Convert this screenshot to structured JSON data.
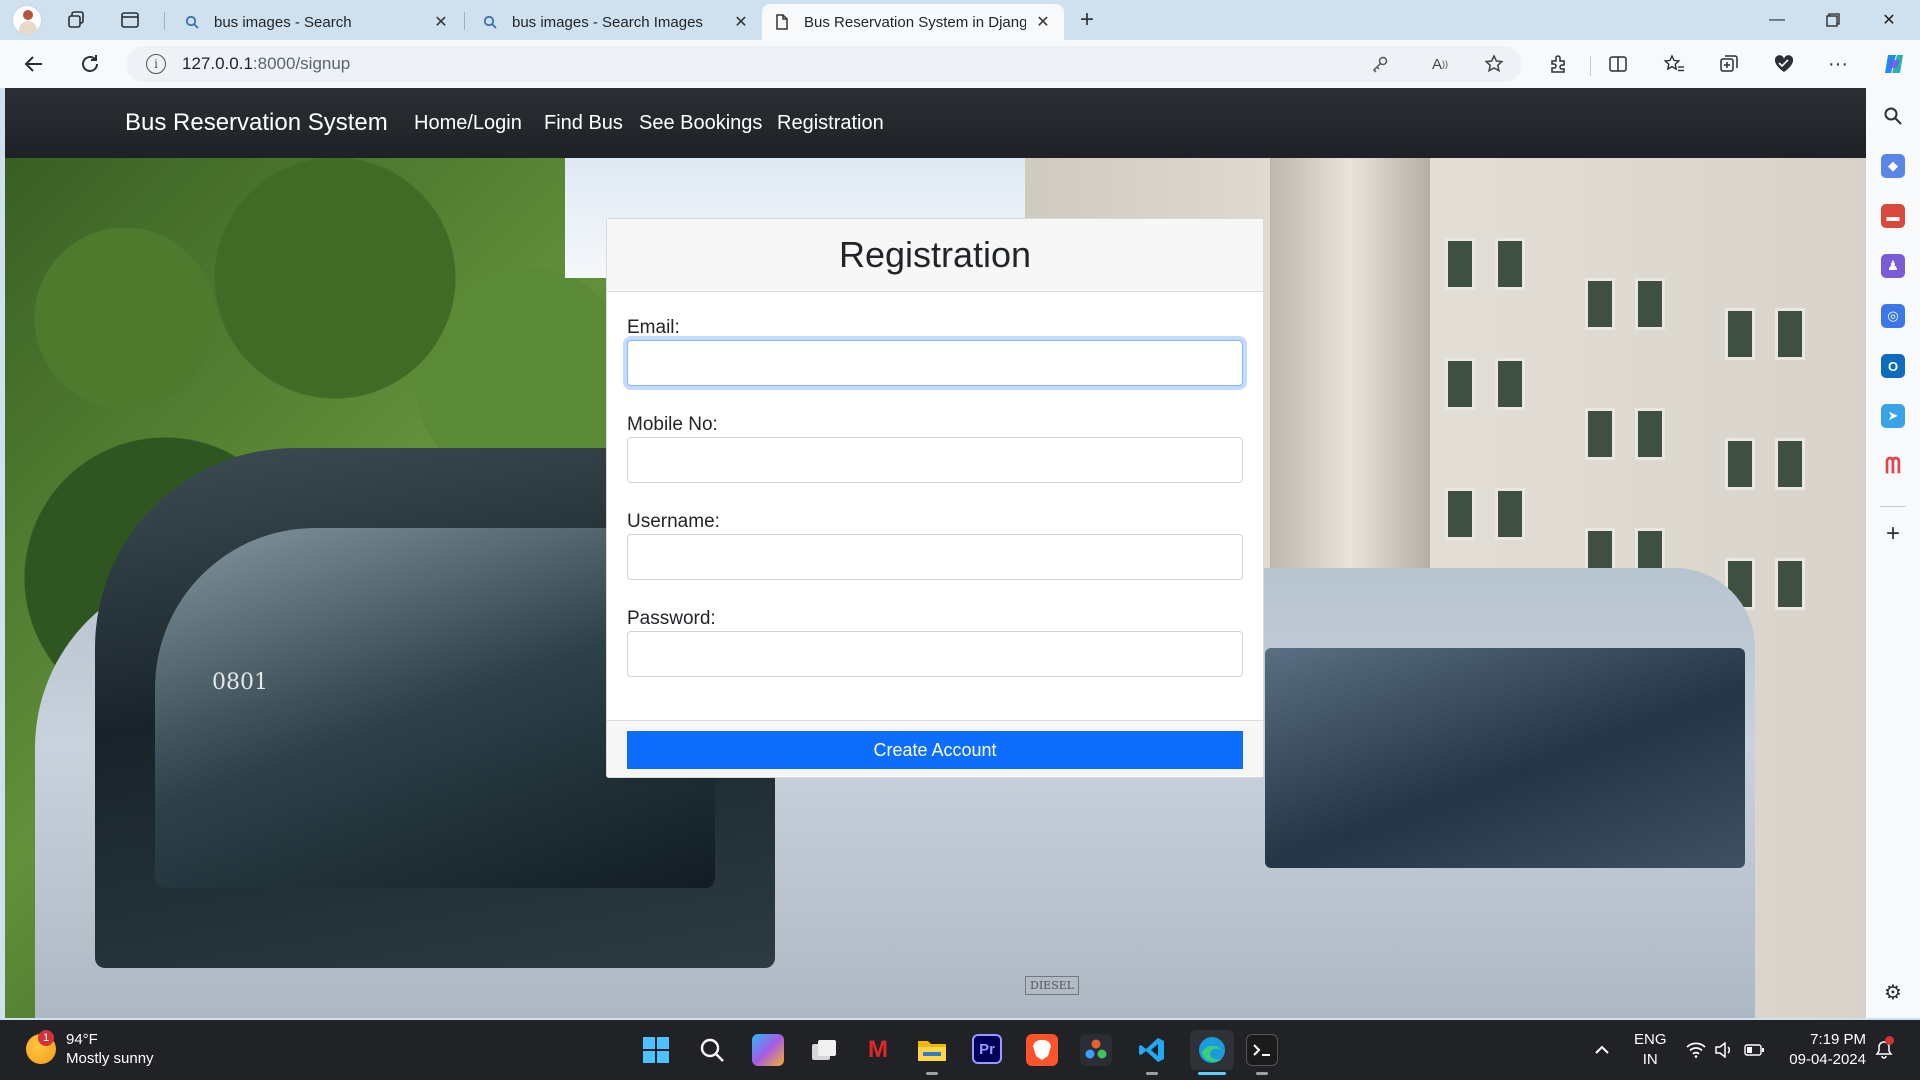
{
  "browser": {
    "tabs": [
      {
        "title": "bus images - Search",
        "icon": "search-icon"
      },
      {
        "title": "bus images - Search Images",
        "icon": "search-icon"
      },
      {
        "title": "Bus Reservation System in Djang",
        "icon": "page-icon",
        "active": true
      }
    ],
    "address": {
      "host": "127.0.0.1",
      "path": ":8000/signup"
    }
  },
  "site": {
    "brand": "Bus Reservation System",
    "nav": [
      {
        "label": "Home/Login"
      },
      {
        "label": "Find Bus"
      },
      {
        "label": "See Bookings"
      },
      {
        "label": "Registration"
      }
    ]
  },
  "form": {
    "title": "Registration",
    "fields": [
      {
        "label": "Email:",
        "value": "",
        "focused": true
      },
      {
        "label": "Mobile No:",
        "value": ""
      },
      {
        "label": "Username:",
        "value": ""
      },
      {
        "label": "Password:",
        "value": ""
      }
    ],
    "submit_label": "Create Account",
    "accent_color": "#0d6efd"
  },
  "background_image": {
    "bus_number": "0801",
    "bus_plate_label": "DIESEL"
  },
  "taskbar": {
    "weather": {
      "temp": "94°F",
      "condition": "Mostly sunny",
      "badge": "1"
    },
    "tray": {
      "lang": "ENG",
      "region": "IN",
      "time": "7:19 PM",
      "date": "09-04-2024"
    },
    "apps": [
      "start-icon",
      "search-icon",
      "copilot-icon",
      "task-view-icon",
      "mcafee-icon",
      "file-explorer-icon",
      "premiere-pro-icon",
      "brave-icon",
      "davinci-icon",
      "vscode-icon",
      "edge-icon",
      "terminal-icon"
    ]
  }
}
